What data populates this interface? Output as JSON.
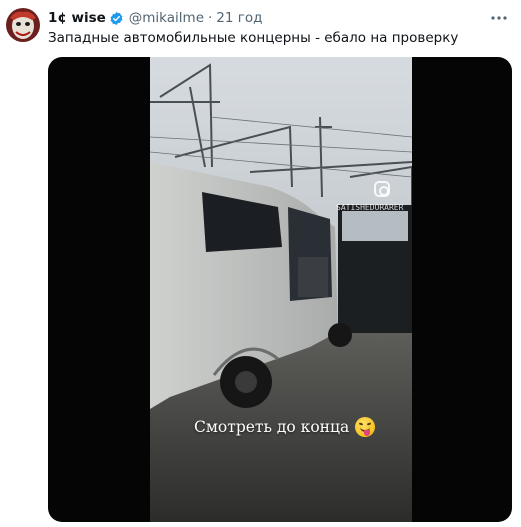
{
  "tweet": {
    "display_name": "1¢ wise",
    "handle": "@mikailme",
    "separator": "·",
    "time": "21 год",
    "text": "Западные автомобильные концерны - ебало на проверку"
  },
  "media": {
    "caption": "Смотреть до конца",
    "caption_emoji": "tongue-wink-emoji",
    "watermark": "SATISHEDORARER",
    "watermark_icon": "instagram-icon"
  },
  "icons": {
    "verified": "verified-badge-icon",
    "more": "more-options-icon"
  },
  "colors": {
    "accent": "#1d9bf0",
    "text_primary": "#0f1419",
    "text_secondary": "#536471",
    "media_background": "#050505"
  }
}
